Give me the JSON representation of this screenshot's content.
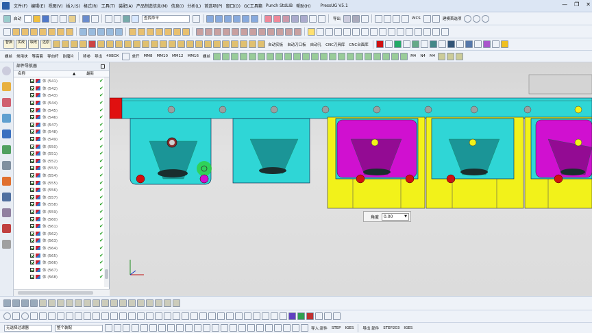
{
  "menubar": {
    "items": [
      "文件(F)",
      "编辑(E)",
      "视图(V)",
      "插入(S)",
      "格式(R)",
      "工具(T)",
      "装配(A)",
      "产品制造信息(M)",
      "信息(I)",
      "分析(L)",
      "首选项(P)",
      "窗口(O)",
      "GC工具箱",
      "Punch StdLIB",
      "帮助(H)"
    ],
    "title": "PressUG V5.1"
  },
  "toolbar1": {
    "start_label": "启动",
    "search_placeholder": "查找命令",
    "export_label": "导出",
    "wcs_label": "WCS",
    "sketch_pref_label": "建模首选项"
  },
  "toolbar3": {
    "labels": [
      "智换",
      "实改",
      "取改",
      "还原",
      "自动实板",
      "自动刀口板",
      "自动孔",
      "CNC刀具库",
      "CNC台面库"
    ]
  },
  "toolbar4": {
    "left_labels": [
      "螺丝",
      "常用块",
      "等高套",
      "导向杆",
      "耐磨片"
    ],
    "mid_labels": [
      "移参",
      "导出",
      "40BOX",
      "单开",
      "MM8",
      "MM10",
      "MM12",
      "MM16",
      "螺丝"
    ],
    "right_labels": [
      "M4",
      "N4",
      "M4"
    ]
  },
  "navigator": {
    "title": "部件导航器",
    "col_name": "名称",
    "col_latest": "最新",
    "rows": [
      "体 (541)",
      "体 (542)",
      "体 (543)",
      "体 (544)",
      "体 (545)",
      "体 (546)",
      "体 (547)",
      "体 (548)",
      "体 (549)",
      "体 (550)",
      "体 (551)",
      "体 (552)",
      "体 (553)",
      "体 (554)",
      "体 (555)",
      "体 (556)",
      "体 (557)",
      "体 (558)",
      "体 (559)",
      "体 (560)",
      "体 (561)",
      "体 (562)",
      "体 (563)",
      "体 (564)",
      "体 (565)",
      "体 (566)",
      "体 (567)",
      "体 (568)"
    ],
    "latest_mark": "✔"
  },
  "angle_popup": {
    "label": "角度",
    "value": "0.00"
  },
  "bottombar": {
    "filter_value": "无选择过滤器",
    "assembly_value": "整个装配",
    "import_label": "导入:部件",
    "step_label": "STEP",
    "iges_label": "IGES",
    "export_label": "导出:部件",
    "step203_label": "STEP203",
    "iges2_label": "IGES"
  },
  "colors": {
    "cyan": "#2fd6d6",
    "magenta": "#d010d0",
    "yellow": "#f2f21a",
    "red": "#d01010",
    "green_tick": "#1a9a1a"
  }
}
